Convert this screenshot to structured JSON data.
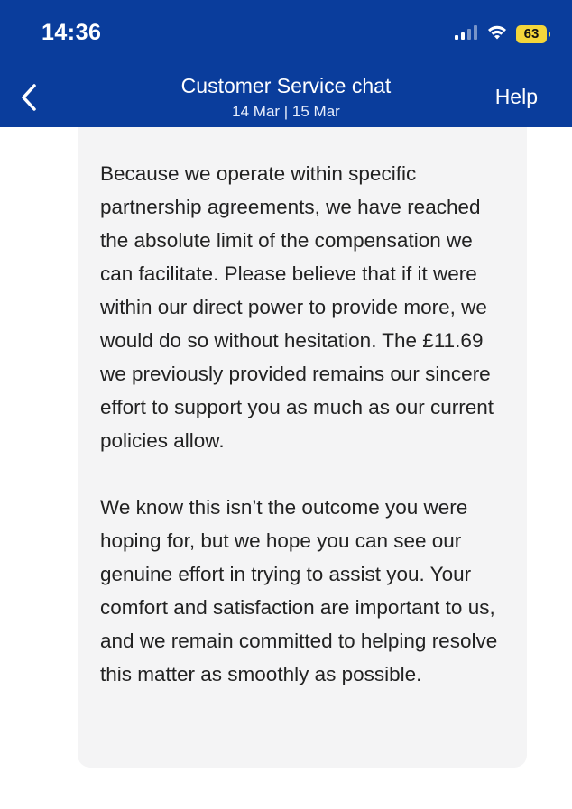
{
  "status_bar": {
    "time": "14:36",
    "battery": "63",
    "battery_color": "#f4d63a"
  },
  "header": {
    "back_icon": "chevron-left-icon",
    "title": "Customer Service chat",
    "subtitle": "14 Mar | 15 Mar",
    "help_label": "Help",
    "background_color": "#0a3d9c"
  },
  "message": {
    "paragraphs": [
      "Because we operate within specific partnership agreements, we have reached the absolute limit of the compensation we can facilitate. Please believe that if it were within our direct power to provide more, we would do so without hesitation. The £11.69 we previously provided remains our sincere effort to support you as much as our current policies allow.",
      "We know this isn’t the outcome you were hoping for, but we hope you can see our genuine effort in trying to assist you. Your comfort and satisfaction are important to us, and we remain committed to helping resolve this matter as smoothly as possible."
    ],
    "bubble_color": "#f4f4f5"
  }
}
